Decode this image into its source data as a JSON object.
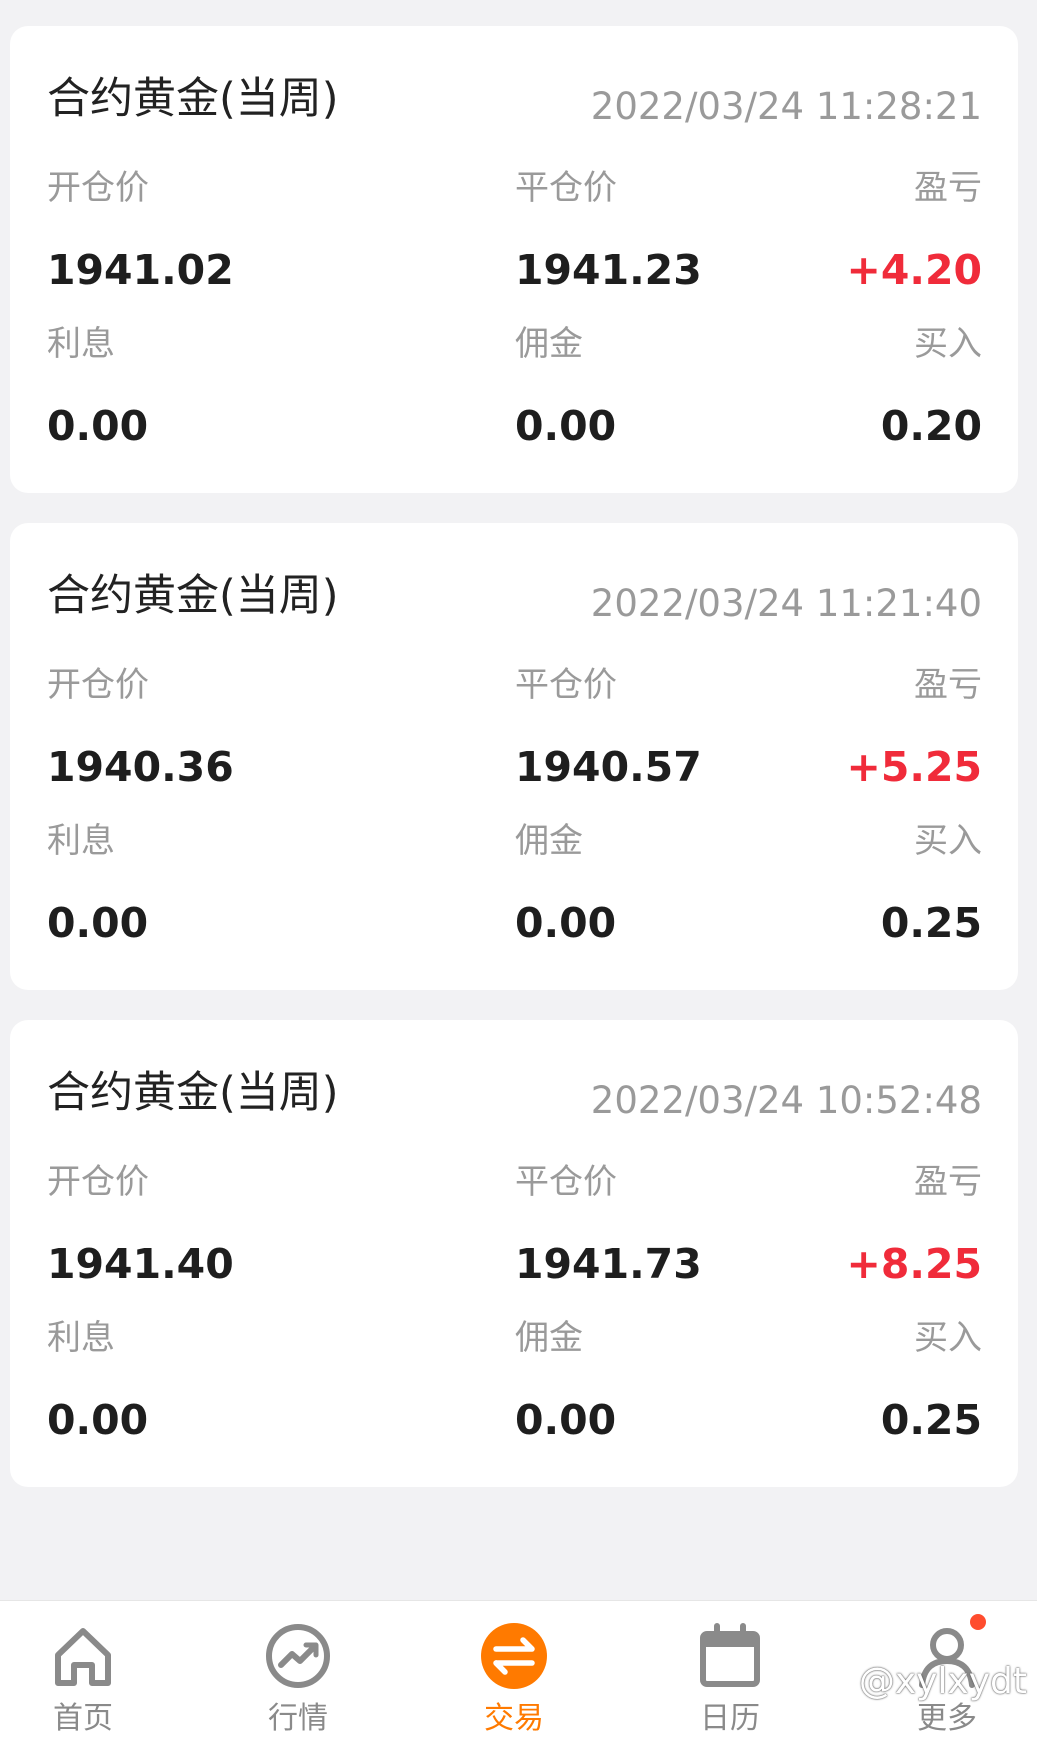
{
  "records": [
    {
      "title": "合约黄金(当周)",
      "time": "2022/03/24 11:28:21",
      "open_label": "开仓价",
      "open_value": "1941.02",
      "close_label": "平仓价",
      "close_value": "1941.23",
      "pnl_label": "盈亏",
      "pnl_value": "+4.20",
      "interest_label": "利息",
      "interest_value": "0.00",
      "commission_label": "佣金",
      "commission_value": "0.00",
      "side_label": "买入",
      "side_value": "0.20"
    },
    {
      "title": "合约黄金(当周)",
      "time": "2022/03/24 11:21:40",
      "open_label": "开仓价",
      "open_value": "1940.36",
      "close_label": "平仓价",
      "close_value": "1940.57",
      "pnl_label": "盈亏",
      "pnl_value": "+5.25",
      "interest_label": "利息",
      "interest_value": "0.00",
      "commission_label": "佣金",
      "commission_value": "0.00",
      "side_label": "买入",
      "side_value": "0.25"
    },
    {
      "title": "合约黄金(当周)",
      "time": "2022/03/24 10:52:48",
      "open_label": "开仓价",
      "open_value": "1941.40",
      "close_label": "平仓价",
      "close_value": "1941.73",
      "pnl_label": "盈亏",
      "pnl_value": "+8.25",
      "interest_label": "利息",
      "interest_value": "0.00",
      "commission_label": "佣金",
      "commission_value": "0.00",
      "side_label": "买入",
      "side_value": "0.25"
    }
  ],
  "tabs": [
    {
      "label": "首页",
      "icon": "home-icon"
    },
    {
      "label": "行情",
      "icon": "market-trend-icon"
    },
    {
      "label": "交易",
      "icon": "trade-swap-icon",
      "active": true
    },
    {
      "label": "日历",
      "icon": "calendar-icon"
    },
    {
      "label": "更多",
      "icon": "user-icon",
      "badge": true
    }
  ],
  "watermark": "@xylxydt",
  "colors": {
    "accent": "#ff7a00",
    "profit": "#f02b3a",
    "badge": "#ff4d2e",
    "background": "#f2f2f4"
  }
}
